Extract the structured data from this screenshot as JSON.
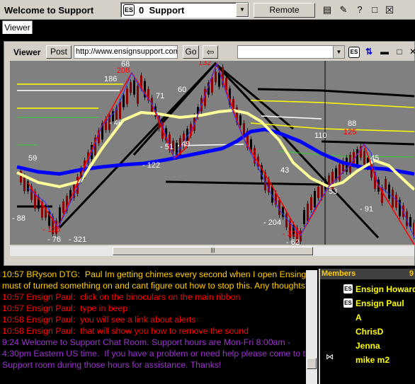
{
  "app": {
    "title": "Welcome to Support"
  },
  "room": {
    "icon": "es-logo-icon",
    "count": "0",
    "name": "Support"
  },
  "toolbar": {
    "remote_label": "Remote Support"
  },
  "tabs": [
    {
      "label": "Viewer"
    }
  ],
  "viewer": {
    "label": "Viewer",
    "post_label": "Post",
    "url": "http://www.ensignsupport.com",
    "go_label": "Go"
  },
  "chart_data": {
    "type": "line",
    "title": "",
    "price_labels": [
      {
        "text": "68",
        "color": "#ffffff"
      },
      {
        "text": "208",
        "color": "#ff0000"
      },
      {
        "text": "186",
        "color": "#ffffff"
      },
      {
        "text": "132",
        "color": "#ff0000"
      },
      {
        "text": "60",
        "color": "#ffffff"
      },
      {
        "text": "71",
        "color": "#ffffff"
      },
      {
        "text": "- 46",
        "color": "#ffffff"
      },
      {
        "text": "59",
        "color": "#ffffff"
      },
      {
        "text": "- 51",
        "color": "#ffffff"
      },
      {
        "text": "49",
        "color": "#ffffff"
      },
      {
        "text": "- 122",
        "color": "#ffffff"
      },
      {
        "text": "110",
        "color": "#ffffff"
      },
      {
        "text": "88",
        "color": "#ffffff"
      },
      {
        "text": "125",
        "color": "#ff0000"
      },
      {
        "text": "45",
        "color": "#ffffff"
      },
      {
        "text": "43",
        "color": "#ffffff"
      },
      {
        "text": "53",
        "color": "#ffffff"
      },
      {
        "text": "- 91",
        "color": "#ffffff"
      },
      {
        "text": "- 88",
        "color": "#ffffff"
      },
      {
        "text": "- 126",
        "color": "#ff0000"
      },
      {
        "text": "- 76",
        "color": "#ffffff"
      },
      {
        "text": "- 321",
        "color": "#ffffff"
      },
      {
        "text": "- 204",
        "color": "#ffffff"
      },
      {
        "text": "- 223",
        "color": "#ff0000"
      },
      {
        "text": "- 62",
        "color": "#ffffff"
      }
    ],
    "colors": {
      "background": "#808080",
      "ma_fast": "#ffff99",
      "ma_slow": "#0000ff",
      "zigzag": "#ff0000",
      "channel": "#000000"
    }
  },
  "chat": {
    "messages": [
      {
        "text": "10:57 BRyson DTG:  Paul Im getting chimes every second when I open Ensing. I must of turned something on and cant figure out how to stop this. Any thoughts?",
        "color": "#ffcc00"
      },
      {
        "text": "10:57 Ensign Paul:  click on the binoculars on the main ribbon",
        "color": "#ff0000"
      },
      {
        "text": "10:57 Ensign Paul:  type in beep",
        "color": "#ff0000"
      },
      {
        "text": "10:58 Ensign Paul:  you will see a link about alerts",
        "color": "#ff0000"
      },
      {
        "text": "10:58 Ensign Paul:  that will show you how to remove the sound",
        "color": "#ff0000"
      },
      {
        "text": "9:24 Welcome to Support Chat Room. Support hours are Mon-Fri 8:00am - 4:30pm Eastern US time.  If you have a problem or need help please come to the Support room during those hours for assistance. Thanks!",
        "color": "#9933cc"
      }
    ]
  },
  "members": {
    "header": "Members",
    "count": "9",
    "list": [
      {
        "name": "Ensign Howard",
        "icon": "es-logo-icon"
      },
      {
        "name": "Ensign Paul",
        "icon": "es-logo-icon"
      },
      {
        "name": "A"
      },
      {
        "name": "ChrisD"
      },
      {
        "name": "Jenna"
      },
      {
        "name": "mike m2"
      }
    ]
  }
}
